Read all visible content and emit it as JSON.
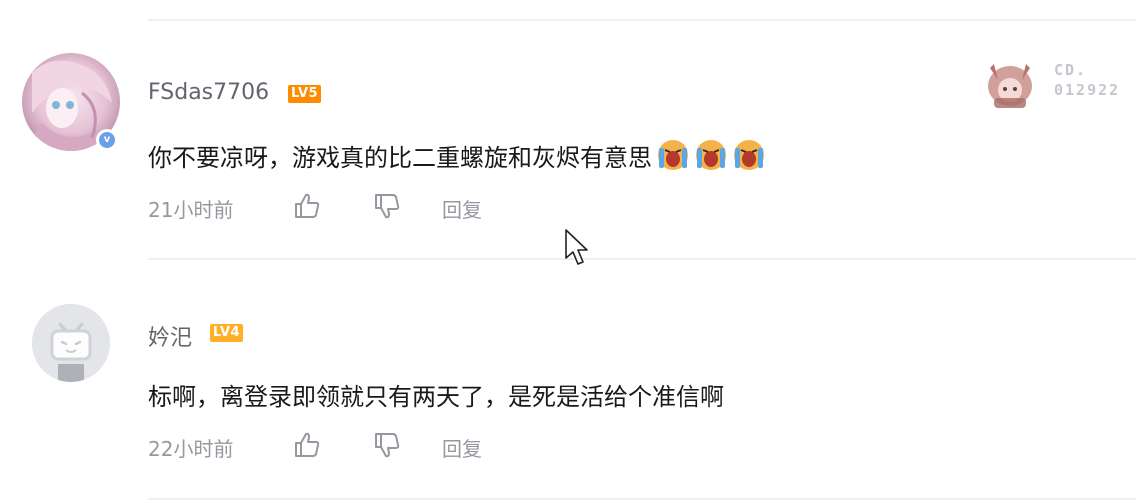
{
  "comments": [
    {
      "username": "FSdas7706",
      "level": "LV5",
      "text": "你不要凉呀，游戏真的比二重螺旋和灰烬有意思",
      "emotes": [
        "crying-emote",
        "crying-emote",
        "crying-emote"
      ],
      "time": "21小时前",
      "reply_label": "回复",
      "verified": true,
      "fan_card": {
        "label": "CD.",
        "number": "012922"
      }
    },
    {
      "username": "妗汜",
      "level": "LV4",
      "text": "标啊，离登录即领就只有两天了，是死是活给个准信啊",
      "time": "22小时前",
      "reply_label": "回复"
    }
  ],
  "colors": {
    "username": "#61666d",
    "content": "#18191c",
    "meta": "#9499a0",
    "divider": "#eeeff1",
    "lv5": "#ff8c00",
    "lv4": "#ffb027"
  }
}
